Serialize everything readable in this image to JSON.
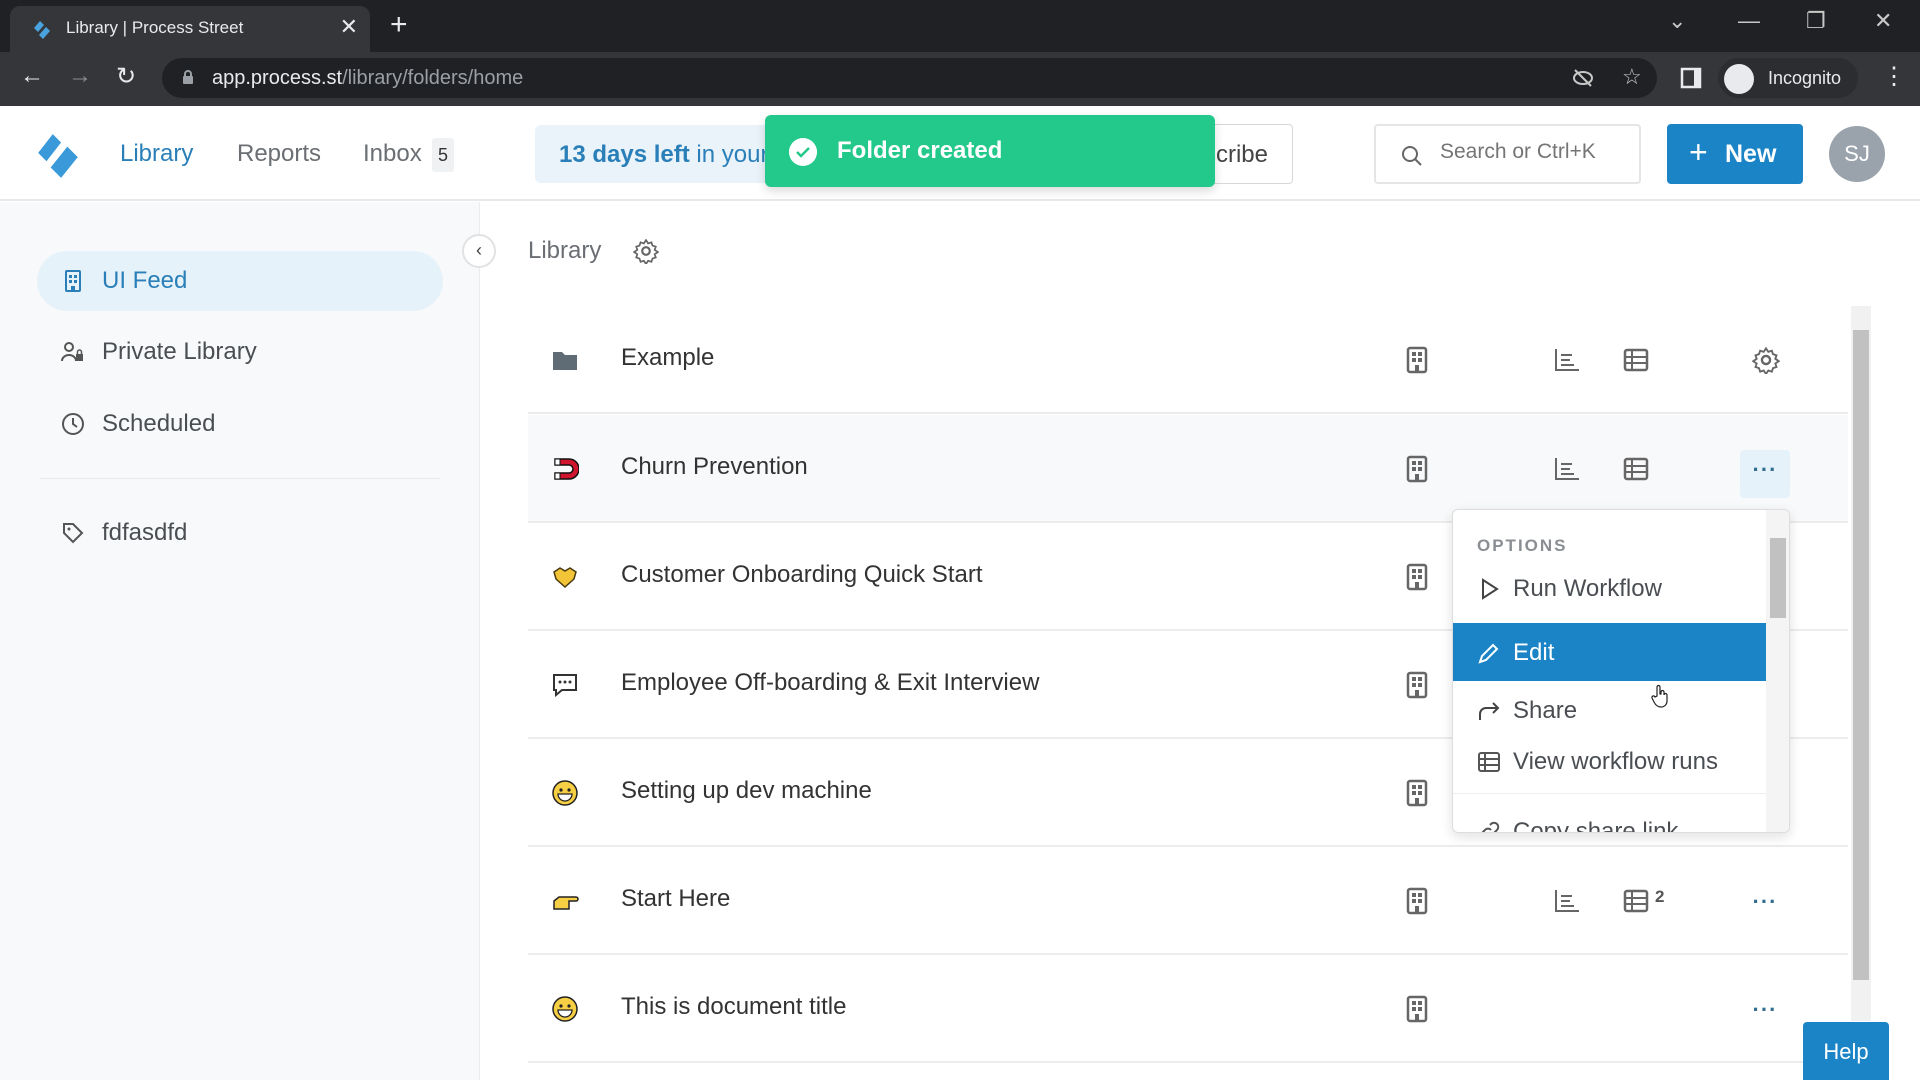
{
  "browser": {
    "tab_title": "Library | Process Street",
    "url_host": "app.process.st",
    "url_path": "/library/folders/home",
    "profile_label": "Incognito"
  },
  "header": {
    "nav": [
      "Library",
      "Reports",
      "Inbox"
    ],
    "inbox_count": "5",
    "trial_bold": "13 days left",
    "trial_rest": " in your trial",
    "subscribe_label": "Subscribe",
    "search_placeholder": "Search or Ctrl+K",
    "new_label": "New",
    "avatar_initials": "SJ"
  },
  "toast": {
    "message": "Folder created",
    "color": "#23c98a"
  },
  "sidebar": {
    "items": [
      {
        "label": "UI Feed",
        "icon": "building-icon",
        "active": true
      },
      {
        "label": "Private Library",
        "icon": "user-lock-icon"
      },
      {
        "label": "Scheduled",
        "icon": "clock-icon"
      }
    ],
    "tags": [
      {
        "label": "fdfasdfd",
        "icon": "tag-icon"
      }
    ]
  },
  "main": {
    "breadcrumb": "Library",
    "rows": [
      {
        "title": "Example",
        "icon": "folder-icon",
        "type": "folder"
      },
      {
        "title": "Churn Prevention",
        "icon": "magnet-icon"
      },
      {
        "title": "Customer Onboarding Quick Start",
        "icon": "handshake-icon"
      },
      {
        "title": "Employee Off-boarding & Exit Interview",
        "icon": "speech-bubble-icon"
      },
      {
        "title": "Setting up dev machine",
        "icon": "grinning-face-icon"
      },
      {
        "title": "Start Here",
        "icon": "pointing-hand-icon",
        "runs_count": "2"
      },
      {
        "title": "This is document title",
        "icon": "grinning-face-icon"
      }
    ]
  },
  "menu": {
    "header": "OPTIONS",
    "items": [
      {
        "label": "Run Workflow",
        "icon": "play-icon"
      },
      {
        "label": "Edit",
        "icon": "pencil-icon",
        "selected": true
      },
      {
        "label": "Share",
        "icon": "share-icon"
      },
      {
        "label": "View workflow runs",
        "icon": "table-icon"
      },
      {
        "label": "Copy share link",
        "icon": "link-icon"
      }
    ]
  },
  "help_label": "Help",
  "colors": {
    "brand": "#1b84c6",
    "link": "#2a7fb8",
    "success": "#23c98a"
  }
}
